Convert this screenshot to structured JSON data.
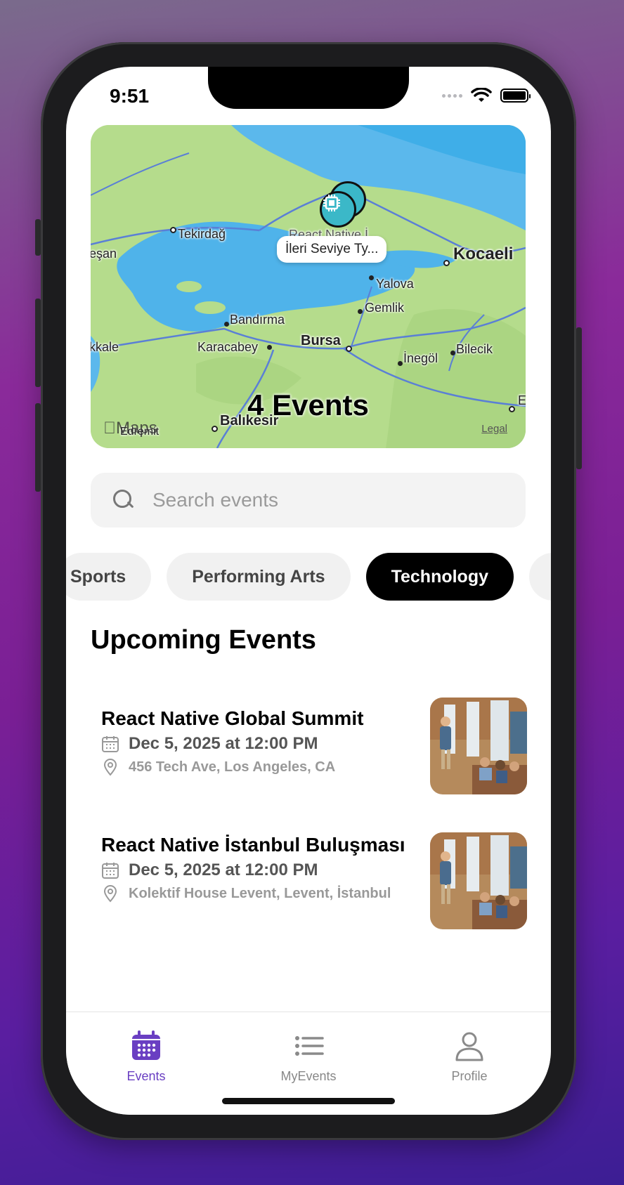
{
  "status": {
    "time": "9:51"
  },
  "map": {
    "count_label": "4 Events",
    "brand": "Maps",
    "legal": "Legal",
    "callout_top": "React Native İ...",
    "callout": "İleri Seviye Ty...",
    "places": {
      "tekirdag": "Tekirdağ",
      "kocaeli": "Kocaeli",
      "yalova": "Yalova",
      "gemlik": "Gemlik",
      "bandirma": "Bandırma",
      "bursa": "Bursa",
      "karacabey": "Karacabey",
      "inegol": "İnegöl",
      "bilecik": "Bilecik",
      "balikesir": "Balıkesir",
      "edremit": "Edremit",
      "kale": "kkale",
      "esan": "eşan",
      "east": "E"
    }
  },
  "search": {
    "placeholder": "Search events"
  },
  "categories": [
    {
      "label": "Sports"
    },
    {
      "label": "Performing Arts"
    },
    {
      "label": "Technology",
      "active": true
    }
  ],
  "section": {
    "title": "Upcoming Events"
  },
  "events": [
    {
      "title": "React Native Global Summit",
      "date": "Dec 5, 2025 at 12:00 PM",
      "location": "456 Tech Ave, Los Angeles, CA"
    },
    {
      "title": "React Native İstanbul Buluşması",
      "date": "Dec 5, 2025 at 12:00 PM",
      "location": "Kolektif House Levent, Levent, İstanbul"
    }
  ],
  "tabs": [
    {
      "label": "Events",
      "icon": "calendar-icon",
      "active": true
    },
    {
      "label": "MyEvents",
      "icon": "list-icon"
    },
    {
      "label": "Profile",
      "icon": "person-icon"
    }
  ],
  "colors": {
    "accent": "#6a3fc2",
    "chip_active": "#000000",
    "pin": "#3bb8c8"
  }
}
